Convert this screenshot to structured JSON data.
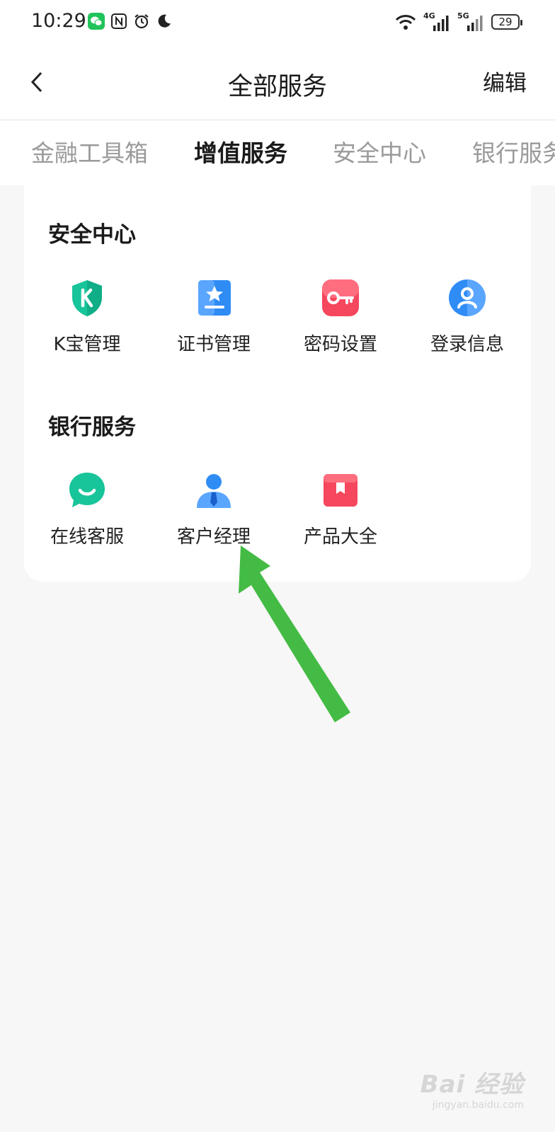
{
  "status_bar": {
    "time": "10:29",
    "signal_1_tag": "4G",
    "signal_2_tag": "5G",
    "battery": "29",
    "icons": [
      "wechat-icon",
      "nfc-icon",
      "alarm-icon",
      "moon-icon",
      "wifi-icon",
      "signal-icon",
      "battery-icon"
    ]
  },
  "header": {
    "title": "全部服务",
    "edit_label": "编辑",
    "back_icon": "chevron-left-icon"
  },
  "tabs": [
    {
      "label": "金融工具箱",
      "active": false
    },
    {
      "label": "增值服务",
      "active": true
    },
    {
      "label": "安全中心",
      "active": false
    },
    {
      "label": "银行服务",
      "active": false
    }
  ],
  "sections": [
    {
      "title": "安全中心",
      "items": [
        {
          "label": "K宝管理",
          "icon": "shield-k-icon",
          "color": "#18c49a"
        },
        {
          "label": "证书管理",
          "icon": "certificate-icon",
          "color": "#2f8cf5"
        },
        {
          "label": "密码设置",
          "icon": "key-icon",
          "color": "#f5475d"
        },
        {
          "label": "登录信息",
          "icon": "user-circle-icon",
          "color": "#2f8cf5"
        }
      ]
    },
    {
      "title": "银行服务",
      "items": [
        {
          "label": "在线客服",
          "icon": "chat-smile-icon",
          "color": "#18c49a"
        },
        {
          "label": "客户经理",
          "icon": "manager-icon",
          "color": "#2f8cf5"
        },
        {
          "label": "产品大全",
          "icon": "product-box-icon",
          "color": "#f5475d"
        }
      ]
    }
  ],
  "annotation": {
    "icon": "arrow-icon",
    "color": "#44bb44"
  },
  "watermark": {
    "logo": "Bai 经验",
    "url": "jingyan.baidu.com"
  }
}
